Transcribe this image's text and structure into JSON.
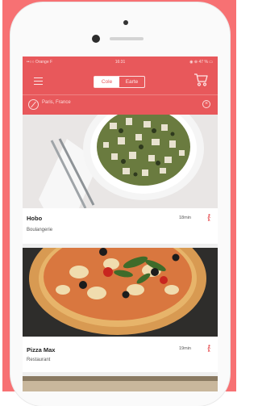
{
  "status_bar": {
    "carrier": "••○○ Orange F  ",
    "time": "16:31",
    "battery": "◉ ⊕ 47 % ▭"
  },
  "header": {
    "tabs": [
      {
        "label": "Cole",
        "active": true
      },
      {
        "label": "Earte",
        "active": false
      }
    ],
    "filter_text": "Paris, France"
  },
  "restaurants": [
    {
      "name": "Hobo",
      "type": "Boulangerie",
      "time": "18min"
    },
    {
      "name": "Pizza Max",
      "type": "Restaurant",
      "time": "19min"
    }
  ],
  "colors": {
    "brand": "#e8585b",
    "background": "#f77173"
  },
  "icons": [
    "menu-icon",
    "cart-icon",
    "filter-icon",
    "clear-icon",
    "walking-icon"
  ]
}
